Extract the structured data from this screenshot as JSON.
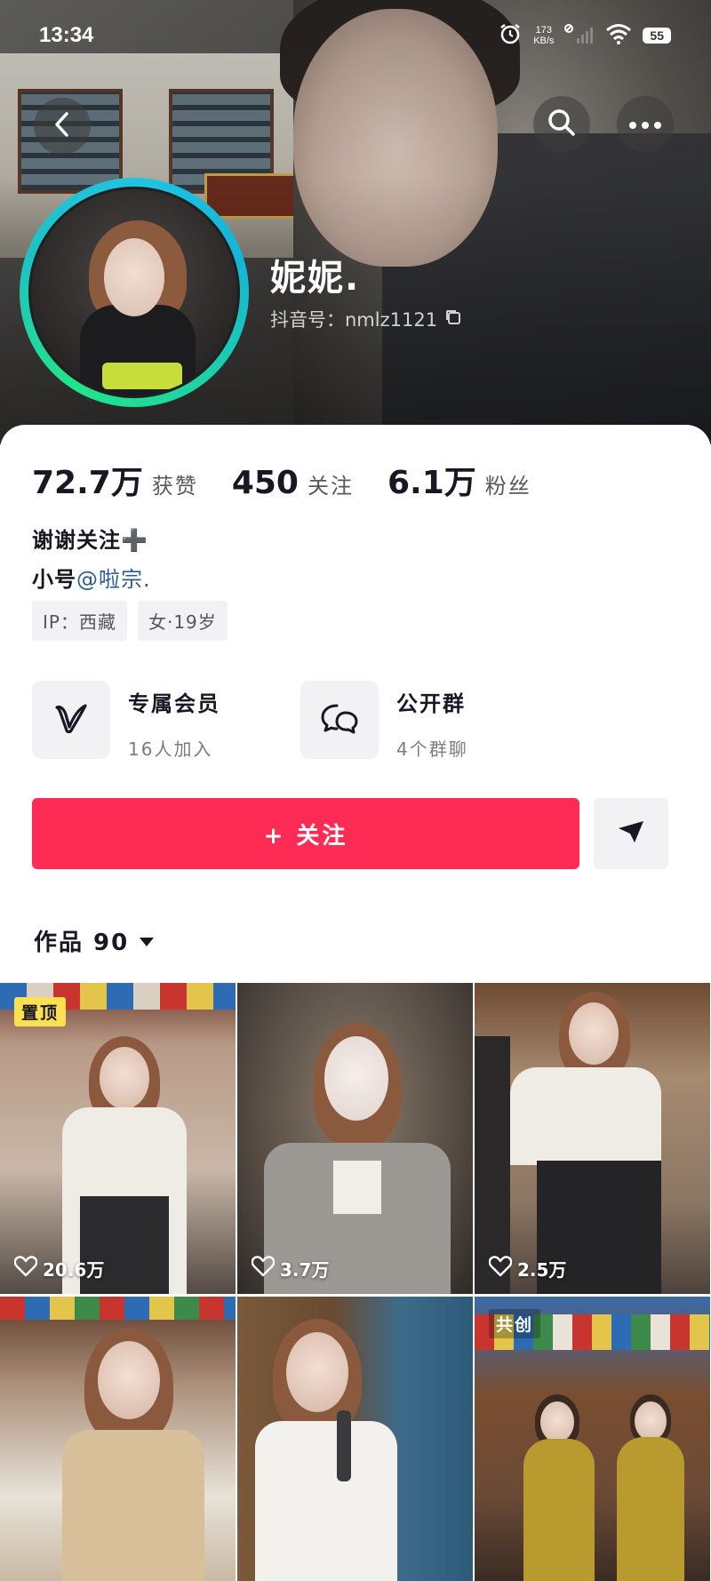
{
  "status_bar": {
    "time": "13:34",
    "net_speed_value": "173",
    "net_speed_unit": "KB/s",
    "battery": "55"
  },
  "profile": {
    "name": "妮妮.",
    "douyin_id": "抖音号：nmlz1121"
  },
  "stats": {
    "likes_count": "72.7万",
    "likes_label": "获赞",
    "following_count": "450",
    "following_label": "关注",
    "followers_count": "6.1万",
    "followers_label": "粉丝"
  },
  "bio": {
    "line1": "谢谢关注➕",
    "line2_prefix": "小号",
    "line2_mention": "@啦宗.",
    "tags": [
      "IP：西藏",
      "女·19岁"
    ]
  },
  "features": {
    "member": {
      "title": "专属会员",
      "subtitle": "16人加入"
    },
    "group": {
      "title": "公开群",
      "subtitle": "4个群聊"
    }
  },
  "actions": {
    "follow_label": "+ 关注"
  },
  "works": {
    "tab_label": "作品 90",
    "videos": [
      {
        "likes": "20.6万",
        "badge": "置顶"
      },
      {
        "likes": "3.7万",
        "badge": ""
      },
      {
        "likes": "2.5万",
        "badge": ""
      },
      {
        "likes": "",
        "badge": ""
      },
      {
        "likes": "",
        "badge": ""
      },
      {
        "likes": "",
        "badge": "共创"
      }
    ]
  },
  "colors": {
    "follow_button": "#fe2c55",
    "avatar_ring": "#20c4e0",
    "pinned_badge": "#fbe054",
    "mention": "#2f5b8f"
  }
}
